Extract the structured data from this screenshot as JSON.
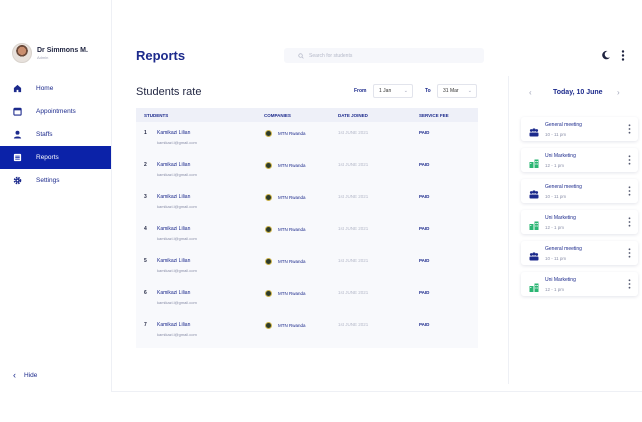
{
  "user": {
    "name": "Dr Simmons M.",
    "role": "Admin"
  },
  "nav": [
    {
      "label": "Home",
      "icon": "home-icon",
      "active": false
    },
    {
      "label": "Appointments",
      "icon": "calendar-icon",
      "active": false
    },
    {
      "label": "Staffs",
      "icon": "person-icon",
      "active": false
    },
    {
      "label": "Reports",
      "icon": "report-icon",
      "active": true
    },
    {
      "label": "Settings",
      "icon": "gear-icon",
      "active": false
    }
  ],
  "hide_label": "Hide",
  "header": {
    "title": "Reports",
    "search_placeholder": "Search for students"
  },
  "section": {
    "title": "Students rate",
    "from_label": "From",
    "from_value": "1 Jan",
    "to_label": "To",
    "to_value": "31 Mar"
  },
  "table": {
    "headers": [
      "STUDENTS",
      "COMPANIES",
      "DATE JOINED",
      "SERVICE FEE"
    ],
    "rows": [
      {
        "num": "1",
        "name": "Kamikazi Lilian",
        "email": "kamikazi.l@gmail.com",
        "company": "MTN Rwanda",
        "date": "1st JUNE 2021",
        "fee": "PAID"
      },
      {
        "num": "2",
        "name": "Kamikazi Lilian",
        "email": "kamikazi.l@gmail.com",
        "company": "MTN Rwanda",
        "date": "1st JUNE 2021",
        "fee": "PAID"
      },
      {
        "num": "3",
        "name": "Kamikazi Lilian",
        "email": "kamikazi.l@gmail.com",
        "company": "MTN Rwanda",
        "date": "1st JUNE 2021",
        "fee": "PAID"
      },
      {
        "num": "4",
        "name": "Kamikazi Lilian",
        "email": "kamikazi.l@gmail.com",
        "company": "MTN Rwanda",
        "date": "1st JUNE 2021",
        "fee": "PAID"
      },
      {
        "num": "5",
        "name": "Kamikazi Lilian",
        "email": "kamikazi.l@gmail.com",
        "company": "MTN Rwanda",
        "date": "1st JUNE 2021",
        "fee": "PAID"
      },
      {
        "num": "6",
        "name": "Kamikazi Lilian",
        "email": "kamikazi.l@gmail.com",
        "company": "MTN Rwanda",
        "date": "1st JUNE 2021",
        "fee": "PAID"
      },
      {
        "num": "7",
        "name": "Kamikazi Lilian",
        "email": "kamikazi.l@gmail.com",
        "company": "MTN Rwanda",
        "date": "1st JUNE 2021",
        "fee": "PAID"
      }
    ]
  },
  "schedule": {
    "day_label": "Today, 10 June",
    "events": [
      {
        "title": "General meeting",
        "time": "10 - 11 pm",
        "icon": "group-icon",
        "color": "#1c2a8c"
      },
      {
        "title": "Uni Marketing",
        "time": "12 - 1 pm",
        "icon": "building-icon",
        "color": "#2bb673"
      },
      {
        "title": "General meeting",
        "time": "10 - 11 pm",
        "icon": "group-icon",
        "color": "#1c2a8c"
      },
      {
        "title": "Uni Marketing",
        "time": "12 - 1 pm",
        "icon": "building-icon",
        "color": "#2bb673"
      },
      {
        "title": "General meeting",
        "time": "10 - 11 pm",
        "icon": "group-icon",
        "color": "#1c2a8c"
      },
      {
        "title": "Uni Marketing",
        "time": "12 - 1 pm",
        "icon": "building-icon",
        "color": "#2bb673"
      }
    ]
  },
  "colors": {
    "primary": "#1c2a8c",
    "active_nav": "#0b22a8",
    "accent_green": "#2bb673"
  }
}
